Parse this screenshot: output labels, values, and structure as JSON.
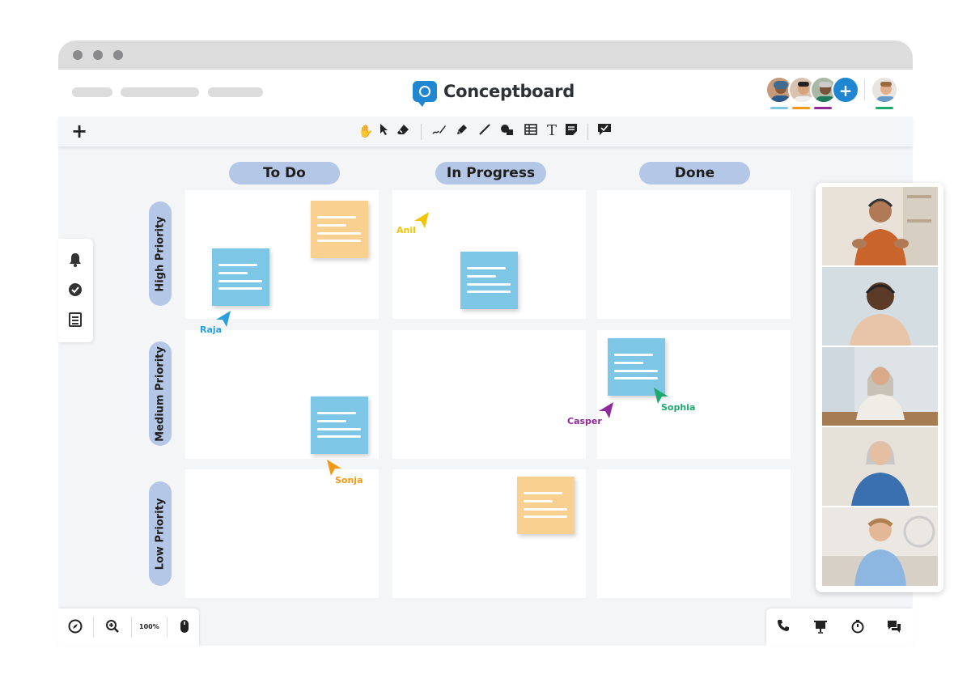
{
  "app": {
    "name": "Conceptboard"
  },
  "toolbar": {
    "tools": [
      "hand",
      "select",
      "eraser",
      "pen",
      "highlighter",
      "line",
      "shapes",
      "table",
      "text",
      "sticky-note",
      "comment"
    ]
  },
  "board": {
    "columns": [
      "To Do",
      "In Progress",
      "Done"
    ],
    "rows": [
      "High Priority",
      "Medium Priority",
      "Low Priority"
    ]
  },
  "cursors": {
    "anil": {
      "name": "Anil",
      "color": "#f5c400"
    },
    "raja": {
      "name": "Raja",
      "color": "#2a9fdc"
    },
    "casper": {
      "name": "Casper",
      "color": "#8e2a9a"
    },
    "sophia": {
      "name": "Sophia",
      "color": "#1eaa6e"
    },
    "sonja": {
      "name": "Sonja",
      "color": "#f29a16"
    }
  },
  "zoom": {
    "level": "100%"
  },
  "colors": {
    "brand": "#1f86d1",
    "header_pill": "#b5c7e6",
    "note_blue": "#7ec6e6",
    "note_orange": "#f9d08f"
  }
}
